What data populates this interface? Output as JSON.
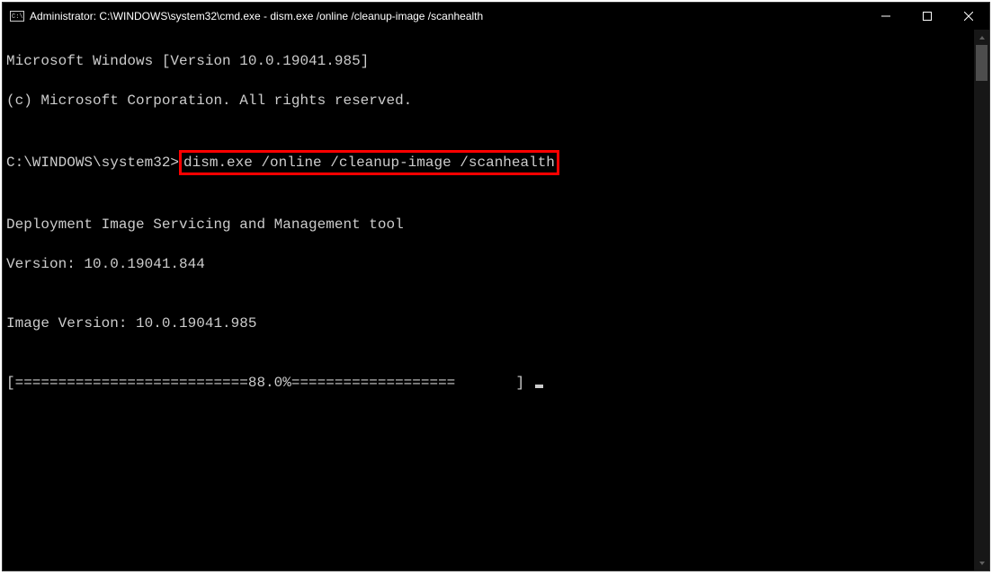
{
  "titlebar": {
    "title": "Administrator: C:\\WINDOWS\\system32\\cmd.exe - dism.exe  /online /cleanup-image /scanhealth"
  },
  "terminal": {
    "line1": "Microsoft Windows [Version 10.0.19041.985]",
    "line2": "(c) Microsoft Corporation. All rights reserved.",
    "blank1": "",
    "prompt_prefix": "C:\\WINDOWS\\system32>",
    "highlighted_command": "dism.exe /online /cleanup-image /scanhealth",
    "blank2": "",
    "tool_name": "Deployment Image Servicing and Management tool",
    "tool_version": "Version: 10.0.19041.844",
    "blank3": "",
    "image_version": "Image Version: 10.0.19041.985",
    "blank4": "",
    "progress": "[===========================88.0%===================       ] "
  }
}
